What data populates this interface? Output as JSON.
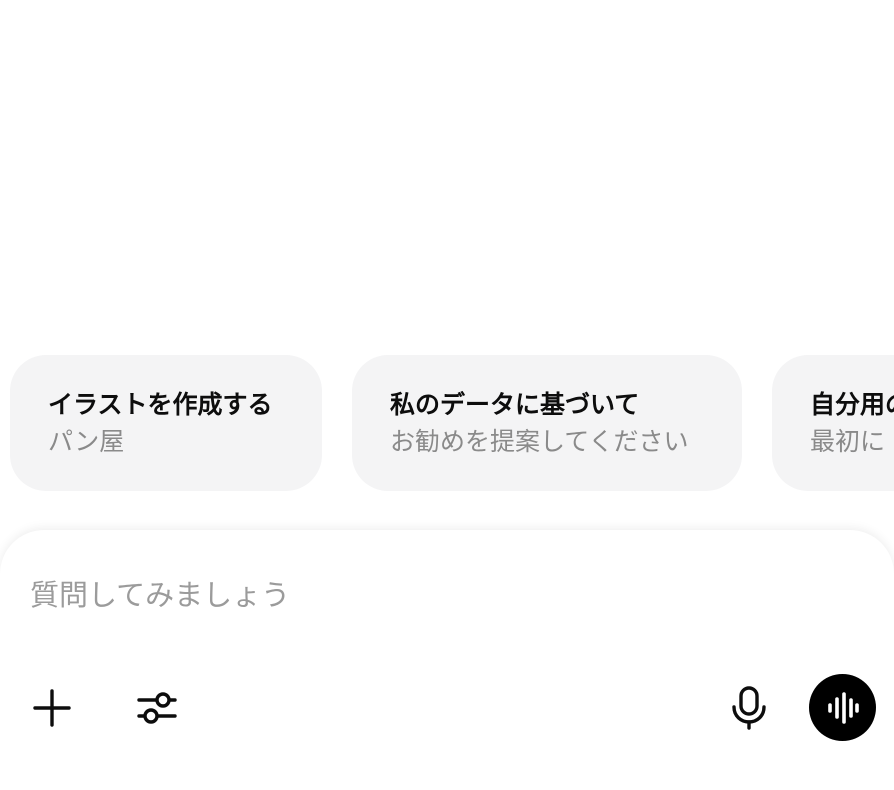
{
  "suggestions": [
    {
      "title": "イラストを作成する",
      "subtitle": "パン屋"
    },
    {
      "title": "私のデータに基づいて",
      "subtitle": "お勧めを提案してください"
    },
    {
      "title": "自分用の",
      "subtitle": "最初に"
    }
  ],
  "composer": {
    "placeholder": "質問してみましょう",
    "value": ""
  },
  "toolbar": {
    "icons": {
      "add": "plus-icon",
      "tools": "sliders-icon",
      "dictate": "microphone-icon",
      "voice": "audio-waveform-icon"
    },
    "voice_button_color": "#000000"
  }
}
